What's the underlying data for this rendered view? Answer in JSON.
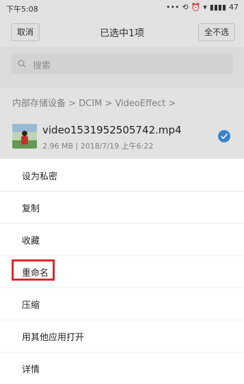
{
  "status_bar": {
    "time": "下午5:08",
    "icons": [
      "dots-icon",
      "sync-off-icon",
      "alarm-icon",
      "wifi-icon",
      "signal-icon"
    ],
    "battery": "47"
  },
  "top_bar": {
    "cancel_label": "取消",
    "title": "已选中1项",
    "select_all_label": "全不选"
  },
  "search": {
    "placeholder": "搜索"
  },
  "breadcrumb": {
    "text": "内部存储设备 > DCIM > VideoEffect >"
  },
  "file": {
    "name": "video1531952505742.mp4",
    "meta": "2.96 MB | 2018/7/19 上午6:22",
    "selected": true
  },
  "menu": {
    "items": [
      {
        "label": "设为私密"
      },
      {
        "label": "复制"
      },
      {
        "label": "收藏"
      },
      {
        "label": "重命名",
        "highlighted": true
      },
      {
        "label": "压缩"
      },
      {
        "label": "用其他应用打开"
      },
      {
        "label": "详情"
      }
    ]
  },
  "colors": {
    "accent": "#3b8fd9",
    "highlight": "#d9282b"
  }
}
